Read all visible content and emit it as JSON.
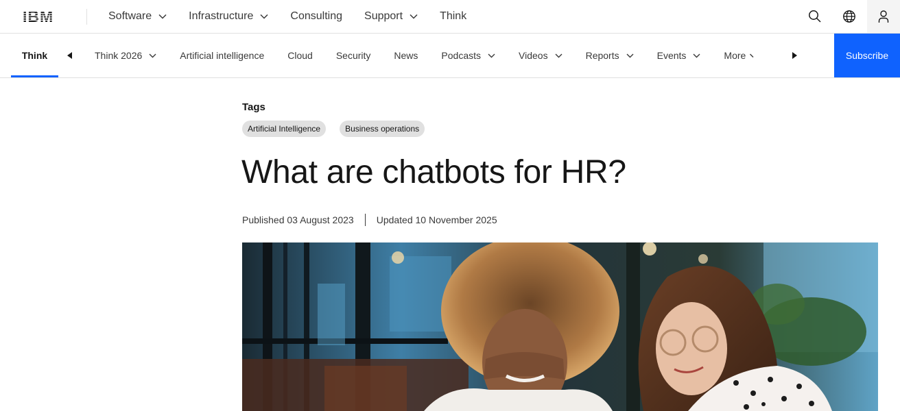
{
  "brand": {
    "logo_text": "IBM"
  },
  "top_nav": [
    {
      "label": "Software",
      "has_menu": true
    },
    {
      "label": "Infrastructure",
      "has_menu": true
    },
    {
      "label": "Consulting",
      "has_menu": false
    },
    {
      "label": "Support",
      "has_menu": true
    },
    {
      "label": "Think",
      "has_menu": false
    }
  ],
  "header_icons": [
    "search-icon",
    "globe-icon",
    "user-icon"
  ],
  "sub_nav": {
    "current": "Think",
    "items": [
      {
        "label": "Think 2026",
        "has_menu": true
      },
      {
        "label": "Artificial intelligence",
        "has_menu": false
      },
      {
        "label": "Cloud",
        "has_menu": false
      },
      {
        "label": "Security",
        "has_menu": false
      },
      {
        "label": "News",
        "has_menu": false
      },
      {
        "label": "Podcasts",
        "has_menu": true
      },
      {
        "label": "Videos",
        "has_menu": true
      },
      {
        "label": "Reports",
        "has_menu": true
      },
      {
        "label": "Events",
        "has_menu": true
      },
      {
        "label": "More",
        "has_menu": true
      }
    ],
    "subscribe_label": "Subscribe"
  },
  "article": {
    "tags_heading": "Tags",
    "tags": [
      "Artificial Intelligence",
      "Business operations"
    ],
    "title": "What are chatbots for HR?",
    "published": "Published 03 August 2023",
    "updated": "Updated 10 November 2025"
  },
  "colors": {
    "accent": "#0f62fe",
    "text": "#161616",
    "border": "#e0e0e0",
    "tag_bg": "#e0e0e0"
  }
}
